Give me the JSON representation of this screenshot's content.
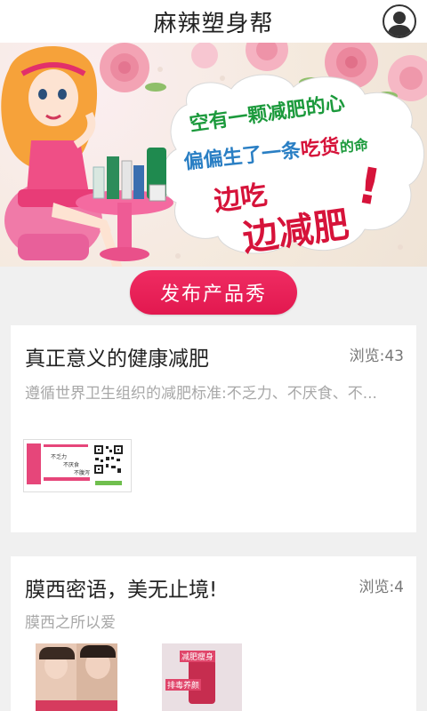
{
  "header": {
    "title": "麻辣塑身帮",
    "avatar_icon": "user-avatar-icon"
  },
  "banner": {
    "line1": "空有一颗减肥的心",
    "line2_pre": "偏偏生了一条",
    "line2_em": "吃货",
    "line2_post": "的命",
    "slogan1": "边吃",
    "slogan2": "边减肥",
    "exclaim": "!"
  },
  "publish_button": "发布产品秀",
  "posts": [
    {
      "title": "真正意义的健康减肥",
      "views": "浏览:43",
      "desc": "遵循世界卫生组织的减肥标准:不乏力、不厌食、不...",
      "thumb": {
        "label_a": "不乏力",
        "label_b": "不厌食",
        "label_c": "不腹泻"
      }
    },
    {
      "title": "膜西密语，美无止境!",
      "views": "浏览:4",
      "desc": "膜西之所以爱",
      "thumb2": {
        "t1": "减肥瘦身",
        "t2": "排毒养颜"
      }
    }
  ],
  "colors": {
    "accent": "#e8215a",
    "green_text": "#1c9a3c",
    "red_text": "#d6133a"
  }
}
